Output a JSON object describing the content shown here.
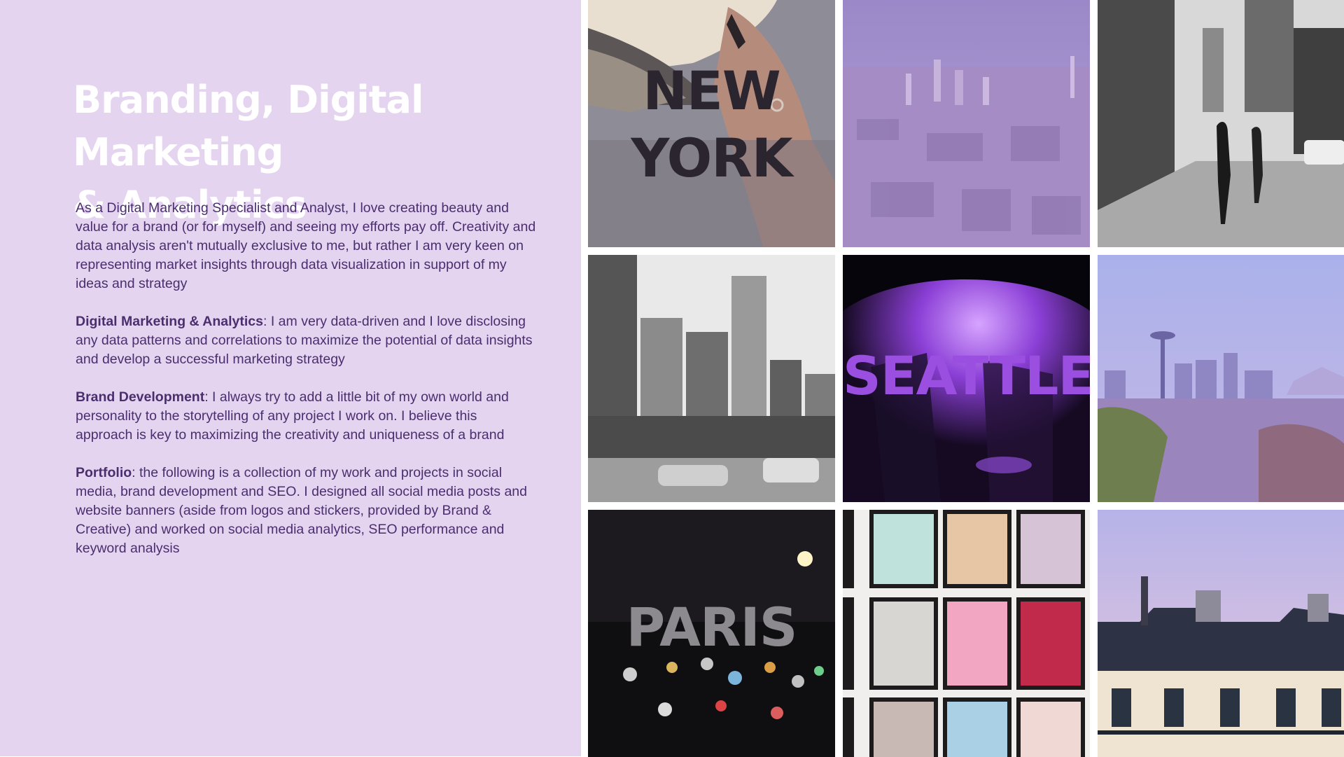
{
  "intro": {
    "title": "Branding, Digital Marketing\n& Analytics",
    "paragraph1": "As a Digital Marketing Specialist and Analyst, I love creating beauty and value for a brand (or for myself) and seeing my efforts pay off. Creativity and data analysis aren't mutually exclusive to me, but rather I am very keen on representing market insights through data visualization in support of my ideas and strategy",
    "section1_heading": "Digital Marketing & Analytics",
    "section1_text": ": I am very data-driven and I love disclosing any data patterns and correlations to maximize the potential of data insights and develop a successful marketing strategy",
    "section2_heading": "Brand Development",
    "section2_text": ": I always try to add a little bit of my own world and personality to the storytelling of any project I work on. I believe this approach is key to maximizing the creativity and uniqueness of a brand",
    "section3_heading": "Portfolio",
    "section3_text": ": the following is a collection of my work and projects in social media, brand development and SEO. I designed all social media posts and website banners (aside from logos and stickers, provided by Brand & Creative) and worked on social media analytics, SEO performance and keyword analysis"
  },
  "gallery": {
    "new_york_label": "NEW\nYORK",
    "seattle_label": "SEATTLE",
    "paris_label": "PARIS"
  },
  "colors": {
    "panel_background": "#e4d4f0",
    "body_text": "#4a2e6e",
    "accent_purple": "#9b4fe0"
  }
}
